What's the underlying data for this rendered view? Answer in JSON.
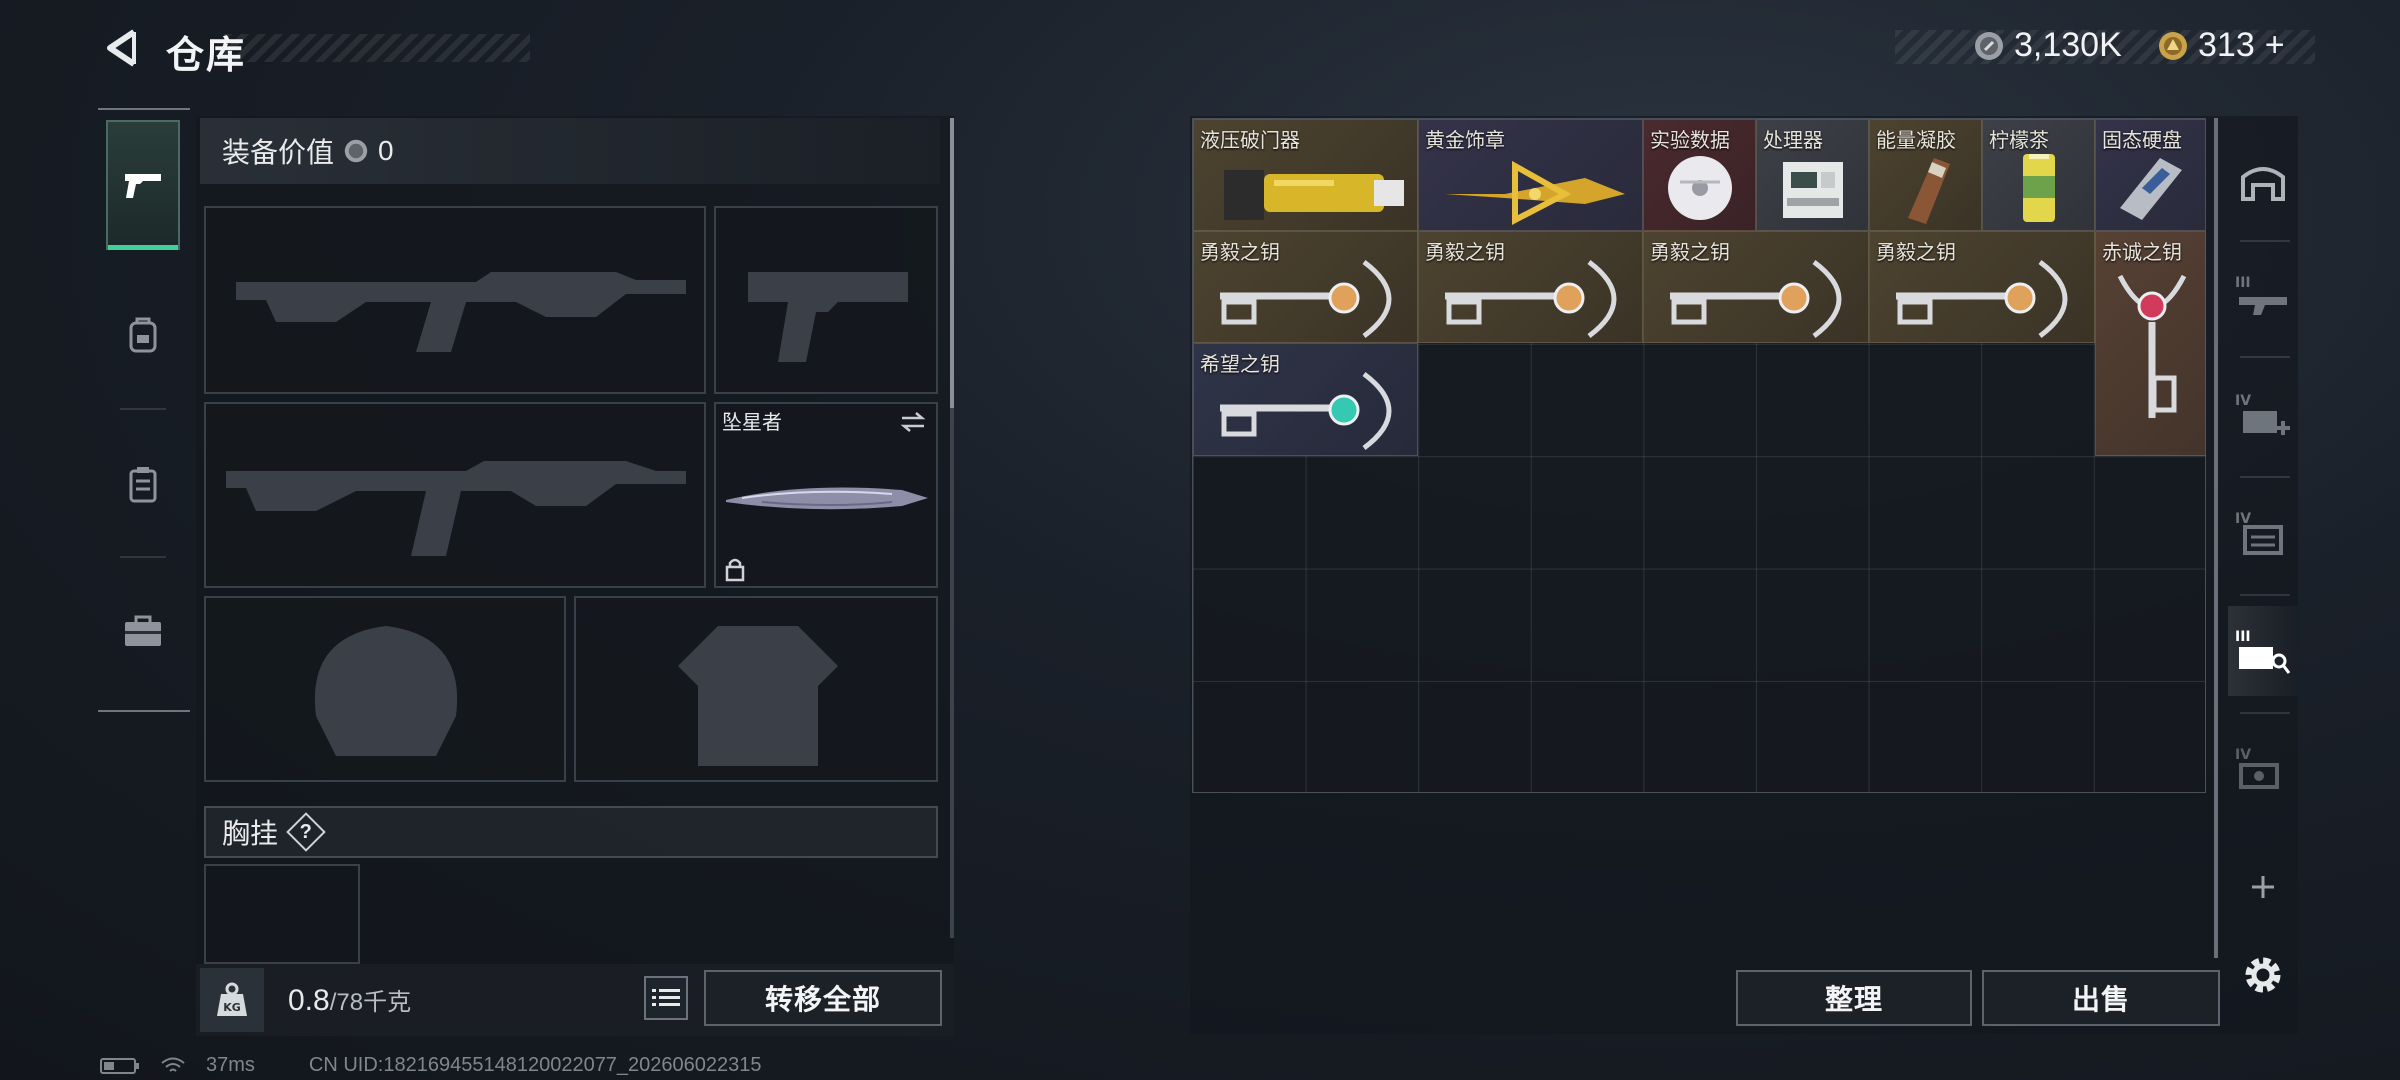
{
  "header": {
    "title": "仓库",
    "currency": [
      {
        "icon": "silver-coin-icon",
        "value": "3,130K"
      },
      {
        "icon": "gold-coin-icon",
        "value": "313"
      }
    ],
    "add_symbol": "+"
  },
  "loadout": {
    "value_label": "装备价值",
    "value": "0",
    "melee_name": "坠星者",
    "chest_rig_label": "胸挂",
    "help_symbol": "?",
    "weight_current": "0.8",
    "weight_capacity": "/78千克",
    "transfer_all_label": "转移全部"
  },
  "storage": {
    "items": [
      {
        "label": "液压破门器",
        "icon": "hydraulic-breacher-icon",
        "quality": "gold"
      },
      {
        "label": "黄金饰章",
        "icon": "golden-emblem-icon",
        "quality": "purple"
      },
      {
        "label": "实验数据",
        "icon": "data-disc-icon",
        "quality": "red"
      },
      {
        "label": "处理器",
        "icon": "processor-icon",
        "quality": "gray"
      },
      {
        "label": "能量凝胶",
        "icon": "energy-gel-icon",
        "quality": "gold"
      },
      {
        "label": "柠檬茶",
        "icon": "lemon-tea-icon",
        "quality": "gray"
      },
      {
        "label": "固态硬盘",
        "icon": "ssd-icon",
        "quality": "purple"
      },
      {
        "label": "勇毅之钥",
        "icon": "key-orange-icon",
        "quality": "gold"
      },
      {
        "label": "勇毅之钥",
        "icon": "key-orange-icon",
        "quality": "gold"
      },
      {
        "label": "勇毅之钥",
        "icon": "key-orange-icon",
        "quality": "gold"
      },
      {
        "label": "勇毅之钥",
        "icon": "key-orange-icon",
        "quality": "gold"
      },
      {
        "label": "赤诚之钥",
        "icon": "key-red-icon",
        "quality": "orange"
      },
      {
        "label": "希望之钥",
        "icon": "key-teal-icon",
        "quality": "blue"
      }
    ],
    "sort_label": "整理",
    "sell_label": "出售"
  },
  "status": {
    "ping": "37ms",
    "uid": "CN UID:18216945514812002​2077_202606022315"
  },
  "colors": {
    "accent_green": "#3fd195",
    "gold_quality": "#4d4330",
    "purple_quality": "#34334a",
    "red_quality": "#4a2a2e"
  }
}
